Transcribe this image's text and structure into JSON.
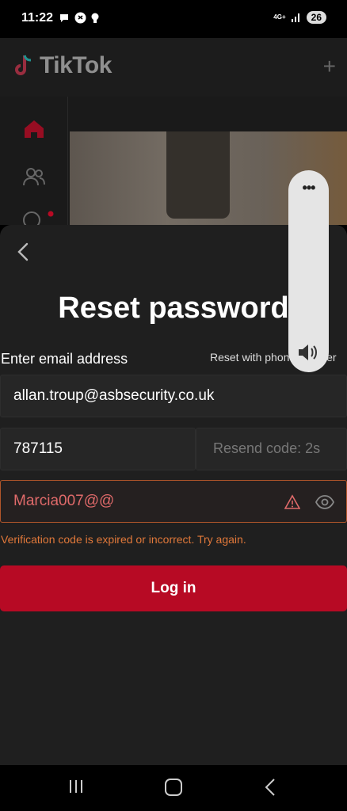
{
  "status_bar": {
    "time": "11:22",
    "network": "4G+",
    "battery": "26"
  },
  "app": {
    "logo_text": "TikTok",
    "plus_glyph": "+",
    "accent_color": "#b70a24"
  },
  "reset_sheet": {
    "title": "Reset password",
    "email_label": "Enter email address",
    "phone_link": "Reset with phone number",
    "email_value": "allan.troup@asbsecurity.co.uk",
    "code_value": "787115",
    "resend_label": "Resend code: 2s",
    "password_value": "Marcia007@@",
    "error_message": "Verification code is expired or incorrect. Try again.",
    "login_label": "Log in"
  },
  "volume_panel": {
    "more_label": "•••"
  }
}
